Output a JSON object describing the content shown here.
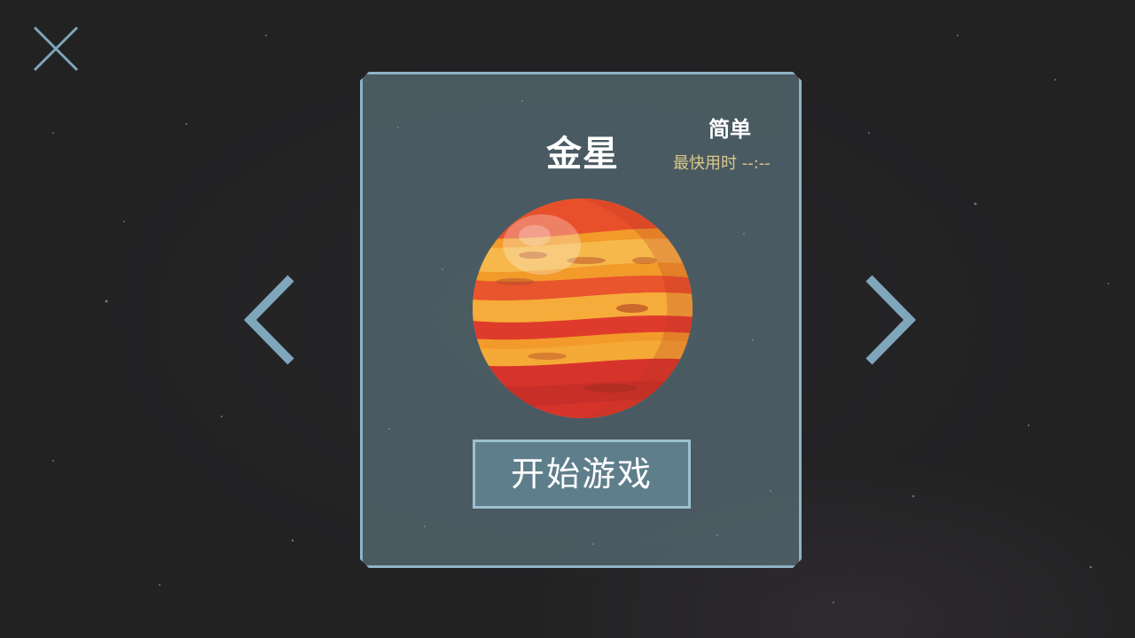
{
  "level_select": {
    "planet_name": "金星",
    "difficulty": "简单",
    "best_time_label": "最快用时 --:--",
    "start_button": "开始游戏"
  },
  "icons": {
    "close": "close-icon",
    "prev": "chevron-left-icon",
    "next": "chevron-right-icon",
    "planet": "venus-planet-illustration"
  },
  "colors": {
    "background": "#222223",
    "panel_border": "#8fb2c4",
    "arrow": "#7fa6bb",
    "best_time_text": "#d8c98a",
    "planet_orange": "#f08a24",
    "planet_red": "#d9362a"
  }
}
